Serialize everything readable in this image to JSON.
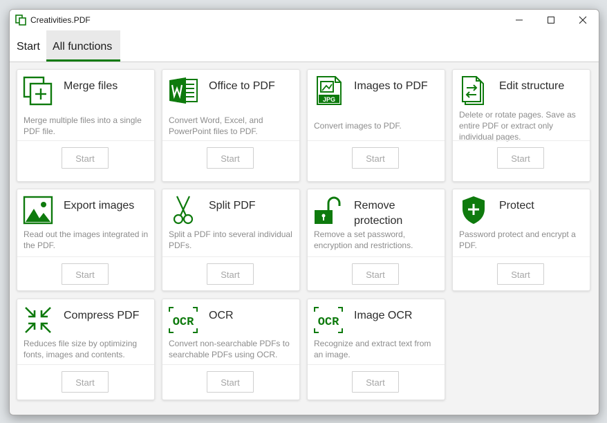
{
  "window": {
    "title": "Creativities.PDF"
  },
  "tabs": [
    {
      "label": "Start"
    },
    {
      "label": "All functions"
    }
  ],
  "accent_color": "#0e7a0d",
  "cards": [
    {
      "title": "Merge files",
      "description": "Merge multiple files into a single PDF file.",
      "button": "Start",
      "icon": "merge-icon"
    },
    {
      "title": "Office to PDF",
      "description": "Convert Word, Excel, and PowerPoint files to PDF.",
      "button": "Start",
      "icon": "word-icon"
    },
    {
      "title": "Images to PDF",
      "description": "Convert images to PDF.",
      "button": "Start",
      "icon": "jpg-file-icon",
      "icon_text": "JPG"
    },
    {
      "title": "Edit structure",
      "description": "Delete or rotate pages. Save as entire PDF or extract only individual pages.",
      "button": "Start",
      "icon": "edit-structure-icon"
    },
    {
      "title": "Export images",
      "description": "Read out the images integrated in the PDF.",
      "button": "Start",
      "icon": "image-icon"
    },
    {
      "title": "Split PDF",
      "description": "Split a PDF into several individual PDFs.",
      "button": "Start",
      "icon": "scissors-icon"
    },
    {
      "title": "Remove protection",
      "description": "Remove a set password, encryption and restrictions.",
      "button": "Start",
      "icon": "unlock-icon"
    },
    {
      "title": "Protect",
      "description": "Password protect and encrypt a PDF.",
      "button": "Start",
      "icon": "shield-icon"
    },
    {
      "title": "Compress PDF",
      "description": "Reduces file size by optimizing fonts, images and contents.",
      "button": "Start",
      "icon": "compress-icon"
    },
    {
      "title": "OCR",
      "description": "Convert non-searchable PDFs to searchable PDFs using OCR.",
      "button": "Start",
      "icon": "ocr-icon",
      "icon_text": "OCR"
    },
    {
      "title": "Image OCR",
      "description": "Recognize and extract text from an image.",
      "button": "Start",
      "icon": "image-ocr-icon",
      "icon_text": "OCR"
    }
  ]
}
